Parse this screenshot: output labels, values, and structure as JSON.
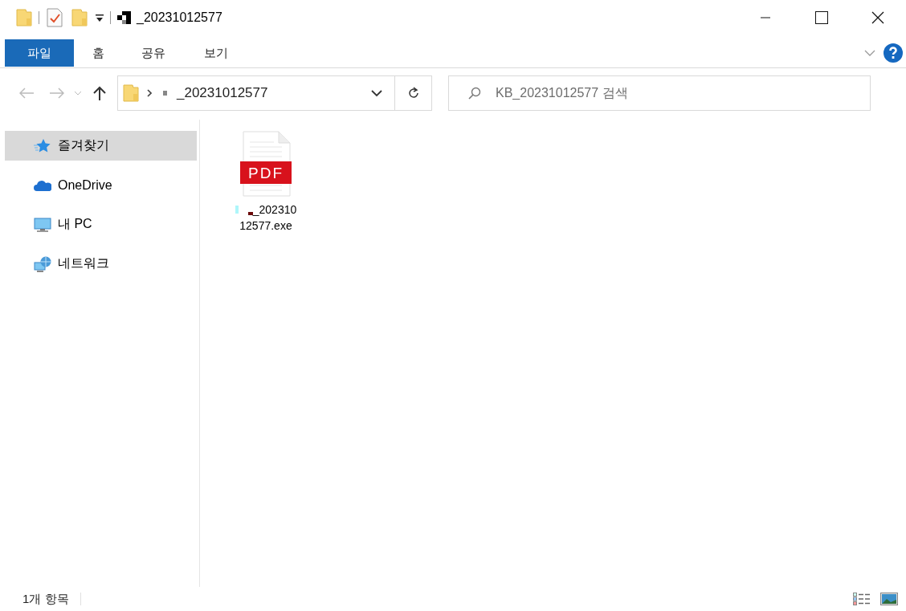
{
  "window": {
    "title": "_20231012577"
  },
  "ribbon": {
    "tabs": [
      {
        "label": "파일",
        "selected": true
      },
      {
        "label": "홈",
        "selected": false
      },
      {
        "label": "공유",
        "selected": false
      },
      {
        "label": "보기",
        "selected": false
      }
    ]
  },
  "address_bar": {
    "path": "_20231012577"
  },
  "search": {
    "placeholder": "KB_20231012577 검색"
  },
  "sidebar": {
    "items": [
      {
        "label": "즐겨찾기",
        "kind": "star",
        "selected": true
      },
      {
        "label": "OneDrive",
        "kind": "cloud",
        "selected": false
      },
      {
        "label": "내 PC",
        "kind": "pc",
        "selected": false
      },
      {
        "label": "네트워크",
        "kind": "network",
        "selected": false
      }
    ]
  },
  "files": [
    {
      "name": "_20231012577.exe",
      "kind": "pdf",
      "icon_text": "PDF"
    }
  ],
  "status_bar": {
    "count": "1개 항목"
  }
}
